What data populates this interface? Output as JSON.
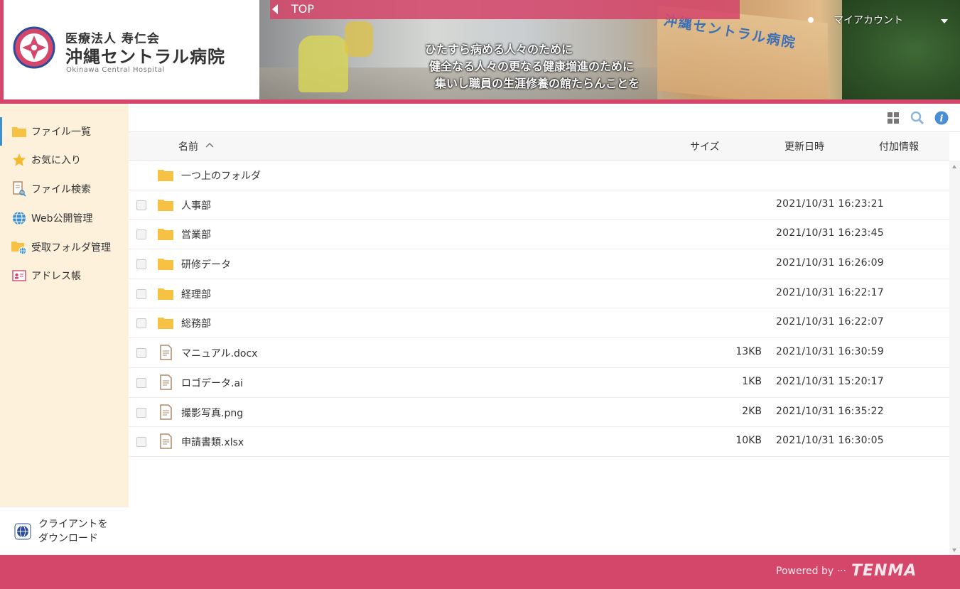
{
  "header": {
    "org_label": "医療法人 寿仁会",
    "hospital_name": "沖縄セントラル病院",
    "hospital_name_en": "Okinawa Central Hospital",
    "top_tab_label": "TOP",
    "tagline": [
      "ひたすら病める人々のために",
      "健全なる人々の更なる健康増進のために",
      "集いし職員の生涯修養の館たらんことを"
    ],
    "building_sign": "沖縄セントラル病院",
    "account_label": "マイアカウント"
  },
  "sidebar": {
    "items": [
      {
        "label": "ファイル一覧",
        "icon": "folder-icon"
      },
      {
        "label": "お気に入り",
        "icon": "star-icon"
      },
      {
        "label": "ファイル検索",
        "icon": "file-search-icon"
      },
      {
        "label": "Web公開管理",
        "icon": "globe-icon"
      },
      {
        "label": "受取フォルダ管理",
        "icon": "folder-globe-icon"
      },
      {
        "label": "アドレス帳",
        "icon": "address-book-icon"
      }
    ],
    "client_download": {
      "line1": "クライアントを",
      "line2": "ダウンロード"
    }
  },
  "file_list": {
    "columns": {
      "name": "名前",
      "size": "サイズ",
      "modified": "更新日時",
      "extra": "付加情報"
    },
    "parent_folder": "一つ上のフォルダ",
    "rows": [
      {
        "name": "人事部",
        "type": "folder",
        "size": "",
        "modified": "2021/10/31 16:23:21"
      },
      {
        "name": "営業部",
        "type": "folder",
        "size": "",
        "modified": "2021/10/31 16:23:45"
      },
      {
        "name": "研修データ",
        "type": "folder",
        "size": "",
        "modified": "2021/10/31 16:26:09"
      },
      {
        "name": "経理部",
        "type": "folder",
        "size": "",
        "modified": "2021/10/31 16:22:17"
      },
      {
        "name": "総務部",
        "type": "folder",
        "size": "",
        "modified": "2021/10/31 16:22:07"
      },
      {
        "name": "マニュアル.docx",
        "type": "file",
        "size": "13KB",
        "modified": "2021/10/31 16:30:59"
      },
      {
        "name": "ロゴデータ.ai",
        "type": "file",
        "size": "1KB",
        "modified": "2021/10/31 15:20:17"
      },
      {
        "name": "撮影写真.png",
        "type": "file",
        "size": "2KB",
        "modified": "2021/10/31 16:35:22"
      },
      {
        "name": "申請書類.xlsx",
        "type": "file",
        "size": "10KB",
        "modified": "2021/10/31 16:30:05"
      }
    ]
  },
  "footer": {
    "powered_by": "Powered by ···",
    "brand": "TENMA"
  },
  "colors": {
    "accent": "#d4476b",
    "sidebar_bg": "#fdf1dc",
    "folder": "#f7c244",
    "info": "#4a8fd6"
  }
}
